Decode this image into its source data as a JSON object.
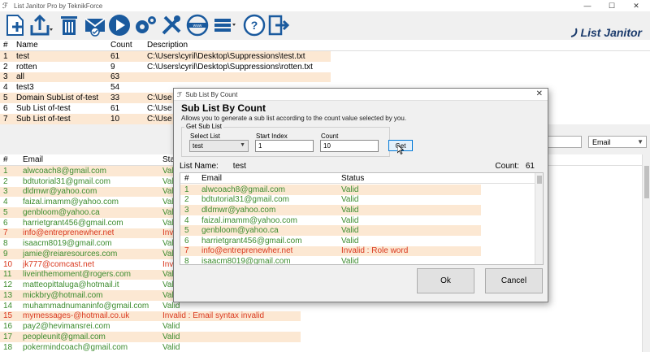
{
  "window": {
    "title": "List Janitor Pro by TeknikForce",
    "minimize": "—",
    "maximize": "☐",
    "close": "✕"
  },
  "toolbar": {
    "icons": [
      "new-list-icon",
      "export-icon",
      "delete-icon",
      "email-verify-icon",
      "run-icon",
      "settings-icon",
      "tools-icon",
      "web-icon",
      "list-menu-icon",
      "help-icon",
      "exit-icon"
    ],
    "brand": "List Janitor"
  },
  "lists_grid": {
    "headers": [
      "#",
      "Name",
      "Count",
      "Description"
    ],
    "rows": [
      {
        "num": "1",
        "name": "test",
        "count": "61",
        "desc": "C:\\Users\\cyril\\Desktop\\Suppressions\\test.txt"
      },
      {
        "num": "2",
        "name": "rotten",
        "count": "9",
        "desc": "C:\\Users\\cyril\\Desktop\\Suppressions\\rotten.txt"
      },
      {
        "num": "3",
        "name": "all",
        "count": "63",
        "desc": ""
      },
      {
        "num": "4",
        "name": "test3",
        "count": "54",
        "desc": ""
      },
      {
        "num": "5",
        "name": "Domain SubList of-test",
        "count": "33",
        "desc": "C:\\Use"
      },
      {
        "num": "6",
        "name": "Sub List of-test",
        "count": "61",
        "desc": "C:\\Use"
      },
      {
        "num": "7",
        "name": "Sub List of-test",
        "count": "10",
        "desc": "C:\\Use"
      }
    ]
  },
  "filter": {
    "search_value": "",
    "field_value": "Email"
  },
  "emails_grid": {
    "headers": [
      "#",
      "Email",
      "Stat"
    ],
    "rows": [
      {
        "num": "1",
        "email": "alwcoach8@gmail.com",
        "status": "Vali",
        "color": "green"
      },
      {
        "num": "2",
        "email": "bdtutorial31@gmail.com",
        "status": "Vali",
        "color": "green"
      },
      {
        "num": "3",
        "email": "dldmwr@yahoo.com",
        "status": "Vali",
        "color": "green"
      },
      {
        "num": "4",
        "email": "faizal.imamm@yahoo.com",
        "status": "Vali",
        "color": "green"
      },
      {
        "num": "5",
        "email": "genbloom@yahoo.ca",
        "status": "Vali",
        "color": "green"
      },
      {
        "num": "6",
        "email": "harrietgrant456@gmail.com",
        "status": "Vali",
        "color": "green"
      },
      {
        "num": "7",
        "email": "info@entreprenewher.net",
        "status": "Inval",
        "color": "red"
      },
      {
        "num": "8",
        "email": "isaacm8019@gmail.com",
        "status": "Vali",
        "color": "green"
      },
      {
        "num": "9",
        "email": "jamie@reiaresources.com",
        "status": "Vali",
        "color": "green"
      },
      {
        "num": "10",
        "email": "jk777@comcast.net",
        "status": "Inval",
        "color": "red"
      },
      {
        "num": "11",
        "email": "liveinthemoment@rogers.com",
        "status": "Vali",
        "color": "green"
      },
      {
        "num": "12",
        "email": "matteopittaluga@hotmail.it",
        "status": "Vali",
        "color": "green"
      },
      {
        "num": "13",
        "email": "mickbry@hotmail.com",
        "status": "Vali",
        "color": "green"
      },
      {
        "num": "14",
        "email": "muhammadnumaninfo@gmail.com",
        "status": "Valid",
        "color": "green"
      },
      {
        "num": "15",
        "email": "mymessages-@hotmail.co.uk",
        "status": "Invalid : Email syntax invalid",
        "color": "red"
      },
      {
        "num": "16",
        "email": "pay2@hevimansrei.com",
        "status": "Valid",
        "color": "green"
      },
      {
        "num": "17",
        "email": "peopleunit@gmail.com",
        "status": "Valid",
        "color": "green"
      },
      {
        "num": "18",
        "email": "pokermindcoach@gmail.com",
        "status": "Valid",
        "color": "green"
      }
    ]
  },
  "dialog": {
    "title": "Sub List By Count",
    "heading": "Sub List By Count",
    "description": "Allows you to generate a sub list according to the count value selected by you.",
    "group_label": "Get Sub List",
    "select_list_label": "Select List",
    "select_list_value": "test",
    "start_index_label": "Start Index",
    "start_index_value": "1",
    "count_label": "Count",
    "count_value": "10",
    "get_button": "Get",
    "list_name_label": "List Name:",
    "list_name_value": "test",
    "count_display_label": "Count:",
    "count_display_value": "61",
    "grid_headers": [
      "#",
      "Email",
      "Status"
    ],
    "rows": [
      {
        "num": "1",
        "email": "alwcoach8@gmail.com",
        "status": "Valid",
        "color": "green"
      },
      {
        "num": "2",
        "email": "bdtutorial31@gmail.com",
        "status": "Valid",
        "color": "green"
      },
      {
        "num": "3",
        "email": "dldmwr@yahoo.com",
        "status": "Valid",
        "color": "green"
      },
      {
        "num": "4",
        "email": "faizal.imamm@yahoo.com",
        "status": "Valid",
        "color": "green"
      },
      {
        "num": "5",
        "email": "genbloom@yahoo.ca",
        "status": "Valid",
        "color": "green"
      },
      {
        "num": "6",
        "email": "harrietgrant456@gmail.com",
        "status": "Valid",
        "color": "green"
      },
      {
        "num": "7",
        "email": "info@entreprenewher.net",
        "status": "Invalid : Role word",
        "color": "red"
      },
      {
        "num": "8",
        "email": "isaacm8019@gmail.com",
        "status": "Valid",
        "color": "green"
      }
    ],
    "ok_button": "Ok",
    "cancel_button": "Cancel"
  },
  "colors": {
    "band": "#fce8d3",
    "valid": "#3d8c2f",
    "invalid": "#d9381e",
    "brand": "#1a3a6b",
    "accent": "#0078d7"
  }
}
